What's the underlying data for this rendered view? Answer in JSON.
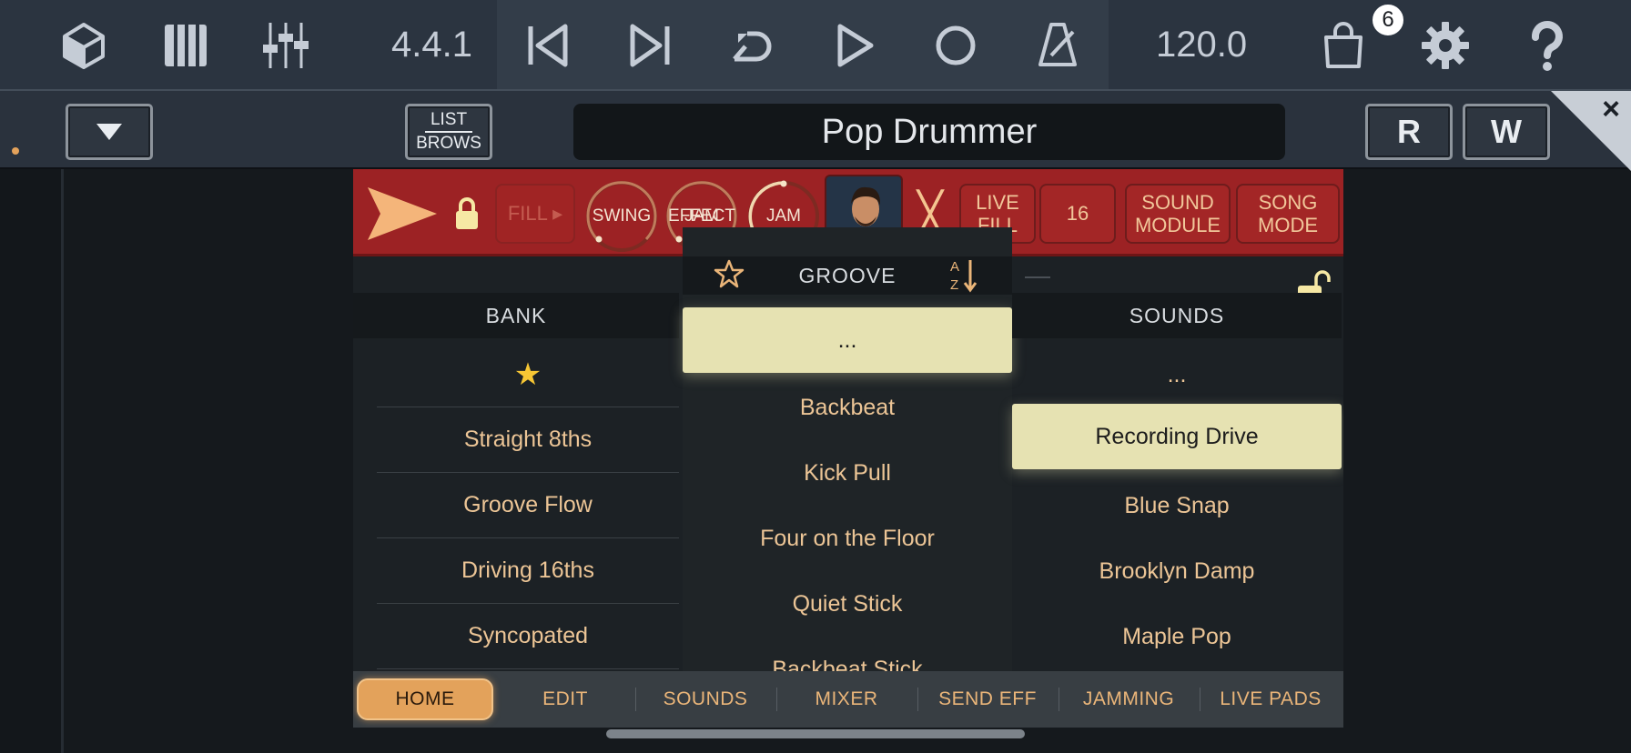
{
  "topbar": {
    "icons": [
      "cube-icon",
      "piano-icon",
      "mixer-faders-icon"
    ],
    "position": "4.4.1",
    "transport": [
      "skip-back-icon",
      "skip-forward-icon",
      "loop-icon",
      "play-icon",
      "record-icon",
      "metronome-icon"
    ],
    "tempo": "120.0",
    "cart_badge": "6",
    "right_icons": [
      "shopping-bag-icon",
      "gear-icon",
      "help-icon"
    ]
  },
  "header2": {
    "list_label_top": "LIST",
    "list_label_bottom": "BROWS",
    "preset_name": "Pop Drummer",
    "r_label": "R",
    "w_label": "W",
    "close_glyph": "×"
  },
  "plugin": {
    "fill_label": "FILL ▸",
    "knobs": {
      "swing": "SWING",
      "jam_effect_line1": "JAM",
      "jam_effect_line2": "EFFECT",
      "jam": "JAM"
    },
    "live_fill_line1": "LIVE",
    "live_fill_line2": "FILL",
    "steps": "16",
    "sound_module_line1": "SOUND",
    "sound_module_line2": "MODULE",
    "song_mode_line1": "SONG",
    "song_mode_line2": "MODE",
    "x_glyph": "╳",
    "bank": {
      "header": "BANK",
      "items": [
        "★",
        "Straight 8ths",
        "Groove Flow",
        "Driving 16ths",
        "Syncopated"
      ]
    },
    "groove": {
      "header": "GROOVE",
      "sort_label_a": "A",
      "sort_label_z": "Z",
      "items": [
        "...",
        "Backbeat",
        "Kick Pull",
        "Four on the Floor",
        "Quiet Stick",
        "Backbeat Stick"
      ],
      "selected_index": 0
    },
    "sounds": {
      "header": "SOUNDS",
      "items": [
        "...",
        "Recording Drive",
        "Blue Snap",
        "Brooklyn Damp",
        "Maple Pop"
      ],
      "selected_index": 1
    },
    "tabs": [
      "HOME",
      "EDIT",
      "SOUNDS",
      "MIXER",
      "SEND EFF",
      "JAMMING",
      "LIVE PADS"
    ],
    "active_tab": "HOME"
  },
  "colors": {
    "accent": "#e3a25b",
    "plugin_header": "#9c2224",
    "selected_row": "#e6e2b2",
    "list_text": "#ecc596"
  }
}
